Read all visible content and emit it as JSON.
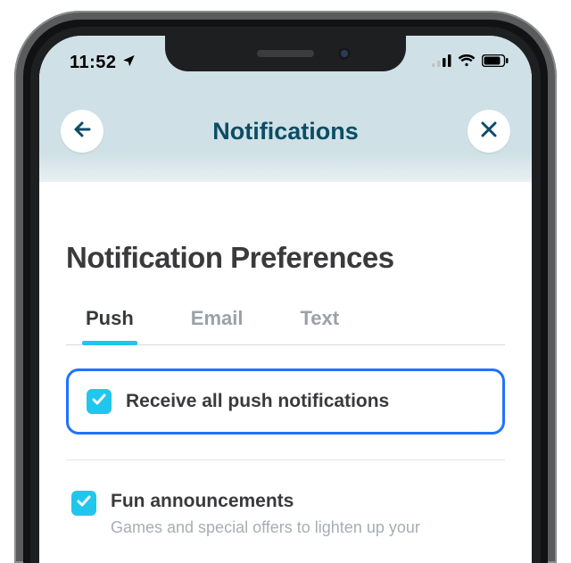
{
  "status": {
    "time": "11:52"
  },
  "header": {
    "title": "Notifications"
  },
  "page": {
    "title": "Notification Preferences",
    "tabs": {
      "push": "Push",
      "email": "Email",
      "text": "Text"
    },
    "receive_all": {
      "label": "Receive all push notifications"
    },
    "fun": {
      "label": "Fun announcements",
      "desc": "Games and special offers to lighten up your"
    }
  }
}
